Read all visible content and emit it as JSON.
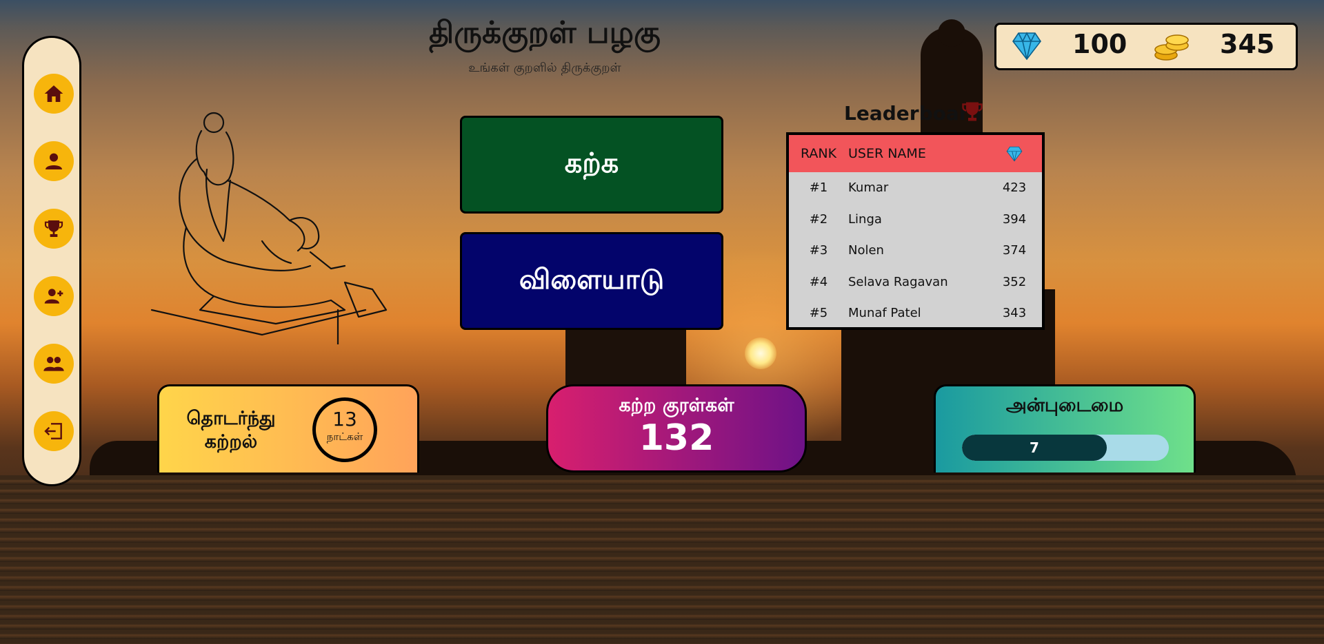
{
  "header": {
    "title": "திருக்குறள் பழகு",
    "subtitle": "உங்கள் குறளில் திருக்குறள்"
  },
  "currency": {
    "gems": "100",
    "coins": "345"
  },
  "sidebar": {
    "items": [
      {
        "icon": "home-icon"
      },
      {
        "icon": "profile-icon"
      },
      {
        "icon": "trophy-icon"
      },
      {
        "icon": "add-user-icon"
      },
      {
        "icon": "group-icon"
      },
      {
        "icon": "logout-icon"
      }
    ]
  },
  "actions": {
    "learn_label": "கற்க",
    "play_label": "விளையாடு"
  },
  "leaderboard": {
    "title": "Leaderboard",
    "columns": {
      "rank": "RANK",
      "name": "USER NAME"
    },
    "rows": [
      {
        "rank": "#1",
        "name": "Kumar",
        "value": "423"
      },
      {
        "rank": "#2",
        "name": "Linga",
        "value": "394"
      },
      {
        "rank": "#3",
        "name": "Nolen",
        "value": "374"
      },
      {
        "rank": "#4",
        "name": "Selava Ragavan",
        "value": "352"
      },
      {
        "rank": "#5",
        "name": "Munaf Patel",
        "value": "343"
      }
    ]
  },
  "stats": {
    "streak": {
      "line1": "தொடர்ந்து",
      "line2": "கற்றல்",
      "days": "13",
      "unit": "நாட்கள்"
    },
    "learned": {
      "label": "கற்ற குரள்கள்",
      "value": "132"
    },
    "love": {
      "label": "அன்புடைமை",
      "value": "7",
      "progress_fraction": 0.7
    }
  },
  "colors": {
    "learn_button": "#045223",
    "play_button": "#03046b",
    "leaderboard_header": "#f2555a",
    "nav_button": "#f7b50c",
    "panel_bg": "#f6e3c0"
  }
}
